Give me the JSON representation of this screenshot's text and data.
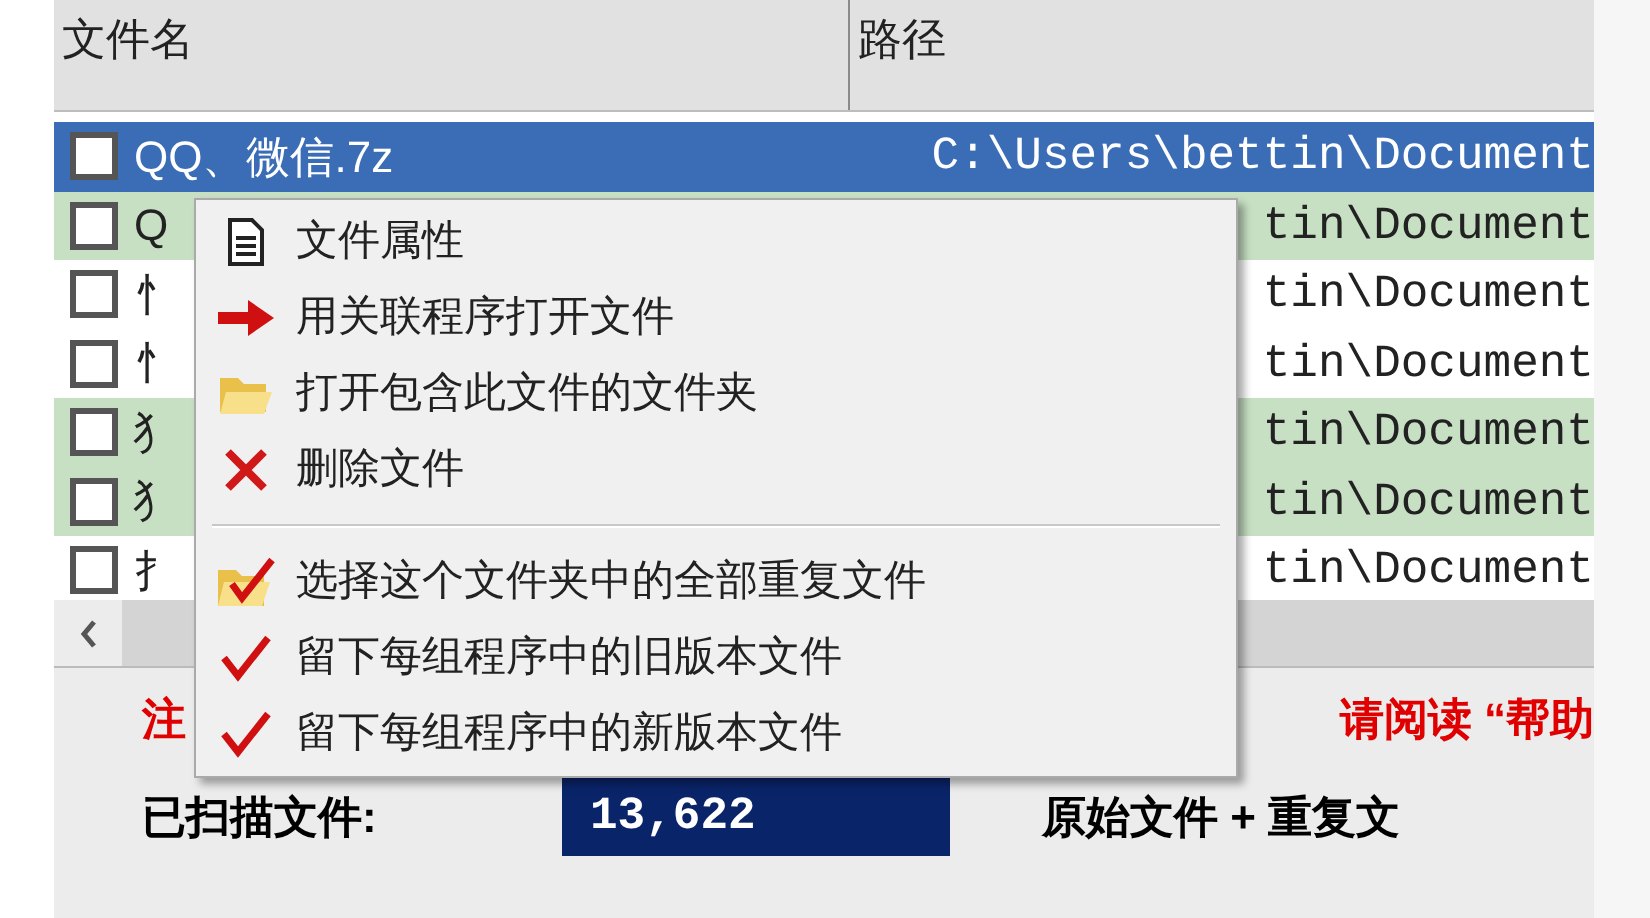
{
  "table": {
    "columns": [
      "文件名",
      "路径"
    ],
    "rows": [
      {
        "name": "QQ、微信.7z",
        "path": "C:\\Users\\bettin\\Document",
        "checked": false,
        "selected": true,
        "highlighted": false
      },
      {
        "name": "Q",
        "path": "tin\\Document",
        "checked": false,
        "selected": false,
        "highlighted": true
      },
      {
        "name": "忄",
        "path": "tin\\Document",
        "checked": false,
        "selected": false,
        "highlighted": false
      },
      {
        "name": "忄",
        "path": "tin\\Document",
        "checked": false,
        "selected": false,
        "highlighted": false
      },
      {
        "name": "犭",
        "path": "tin\\Document",
        "checked": false,
        "selected": false,
        "highlighted": true
      },
      {
        "name": "犭",
        "path": "tin\\Document",
        "checked": false,
        "selected": false,
        "highlighted": true
      },
      {
        "name": "扌",
        "path": "tin\\Document",
        "checked": false,
        "selected": false,
        "highlighted": false
      }
    ]
  },
  "notice": {
    "left": "注",
    "right": "请阅读 “帮助"
  },
  "scanned": {
    "label": "已扫描文件:",
    "value": "13,622"
  },
  "legend": "原始文件 + 重复文",
  "context_menu": {
    "items": [
      {
        "kind": "item",
        "label": "文件属性"
      },
      {
        "kind": "item",
        "label": "用关联程序打开文件"
      },
      {
        "kind": "item",
        "label": "打开包含此文件的文件夹"
      },
      {
        "kind": "item",
        "label": "删除文件"
      },
      {
        "kind": "separator"
      },
      {
        "kind": "item",
        "label": "选择这个文件夹中的全部重复文件"
      },
      {
        "kind": "item",
        "label": "留下每组程序中的旧版本文件"
      },
      {
        "kind": "item",
        "label": "留下每组程序中的新版本文件"
      }
    ]
  }
}
